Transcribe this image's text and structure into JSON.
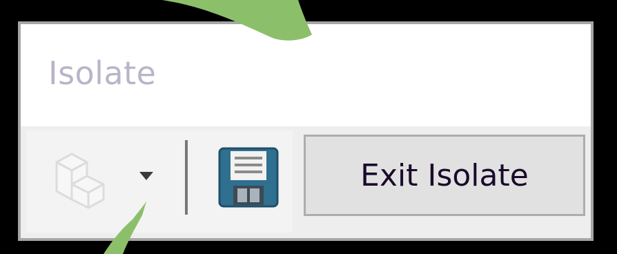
{
  "dialog": {
    "title": "Isolate"
  },
  "toolbar": {
    "display_style_icon": "box-icon",
    "dropdown_icon": "chevron-down-icon",
    "save_icon": "floppy-disk-icon",
    "exit_label": "Exit Isolate"
  },
  "colors": {
    "frame_border": "#a6a6a6",
    "title_text": "#b9b4c8",
    "toolbar_bg": "#eeeeee",
    "button_bg": "#e1e1e1",
    "button_border": "#adadad",
    "save_icon_blue": "#2f6f8f",
    "annotation_green": "#8cbf6a"
  }
}
